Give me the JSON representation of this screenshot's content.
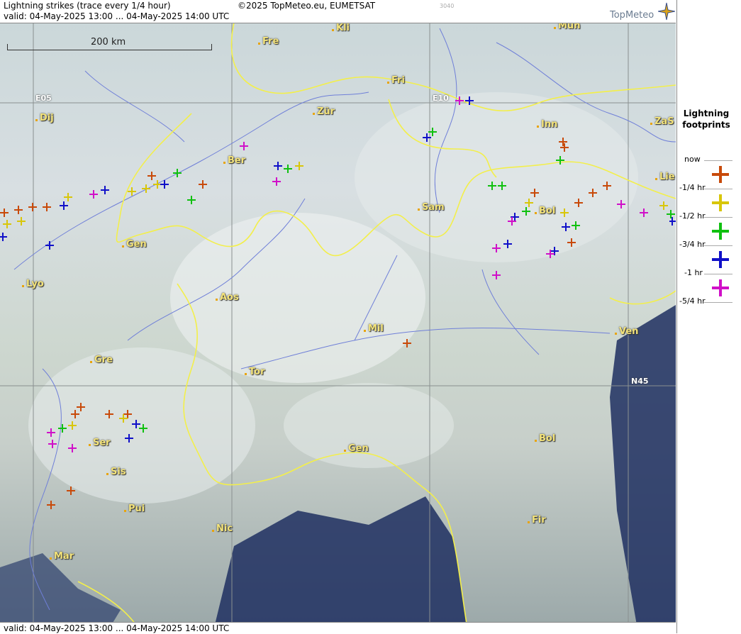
{
  "header": {
    "title": "Lightning strikes (trace every 1/4 hour)",
    "copyright": "©2025 TopMeteo.eu, EUMETSAT",
    "code": "3040",
    "brand": "TopMeteo",
    "valid": "valid:  04-May-2025 13:00 ... 04-May-2025 14:00 UTC"
  },
  "footer": {
    "valid": "valid:  04-May-2025 13:00 ... 04-May-2025 14:00 UTC"
  },
  "scale_label": "200 km",
  "grid_labels": {
    "e05": "E05",
    "e10": "E10",
    "n45": "N45"
  },
  "cities": [
    {
      "name": "Kli"
    },
    {
      "name": "Mun"
    },
    {
      "name": "Fre"
    },
    {
      "name": "Fri"
    },
    {
      "name": "Dij"
    },
    {
      "name": "Zür"
    },
    {
      "name": "Inn"
    },
    {
      "name": "ZaS"
    },
    {
      "name": "Ber"
    },
    {
      "name": "Lie"
    },
    {
      "name": "Sam"
    },
    {
      "name": "Bol"
    },
    {
      "name": "Gen"
    },
    {
      "name": "Lyo"
    },
    {
      "name": "Aos"
    },
    {
      "name": "Mil"
    },
    {
      "name": "Ven"
    },
    {
      "name": "Gre"
    },
    {
      "name": "Tor"
    },
    {
      "name": "Ser"
    },
    {
      "name": "Gen"
    },
    {
      "name": "Bol"
    },
    {
      "name": "Sis"
    },
    {
      "name": "Pui"
    },
    {
      "name": "Nic"
    },
    {
      "name": "Fir"
    },
    {
      "name": "Mar"
    }
  ],
  "legend": {
    "title_line1": "Lightning",
    "title_line2": "footprints",
    "items": [
      {
        "label": "now",
        "color": "#c84a0a"
      },
      {
        "label": "-1/4 hr",
        "color": "#d8c60a"
      },
      {
        "label": "-1/2 hr",
        "color": "#10c010"
      },
      {
        "label": "-3/4 hr",
        "color": "#1010c8"
      },
      {
        "label": "-1 hr",
        "color": "#d010c8"
      },
      {
        "label": "-5/4 hr",
        "color": ""
      }
    ]
  },
  "colors": {
    "border": "#f3ef4a",
    "rivers": "#6f7fd8",
    "city": "#f3e37a",
    "sea": "#1f2f60"
  }
}
